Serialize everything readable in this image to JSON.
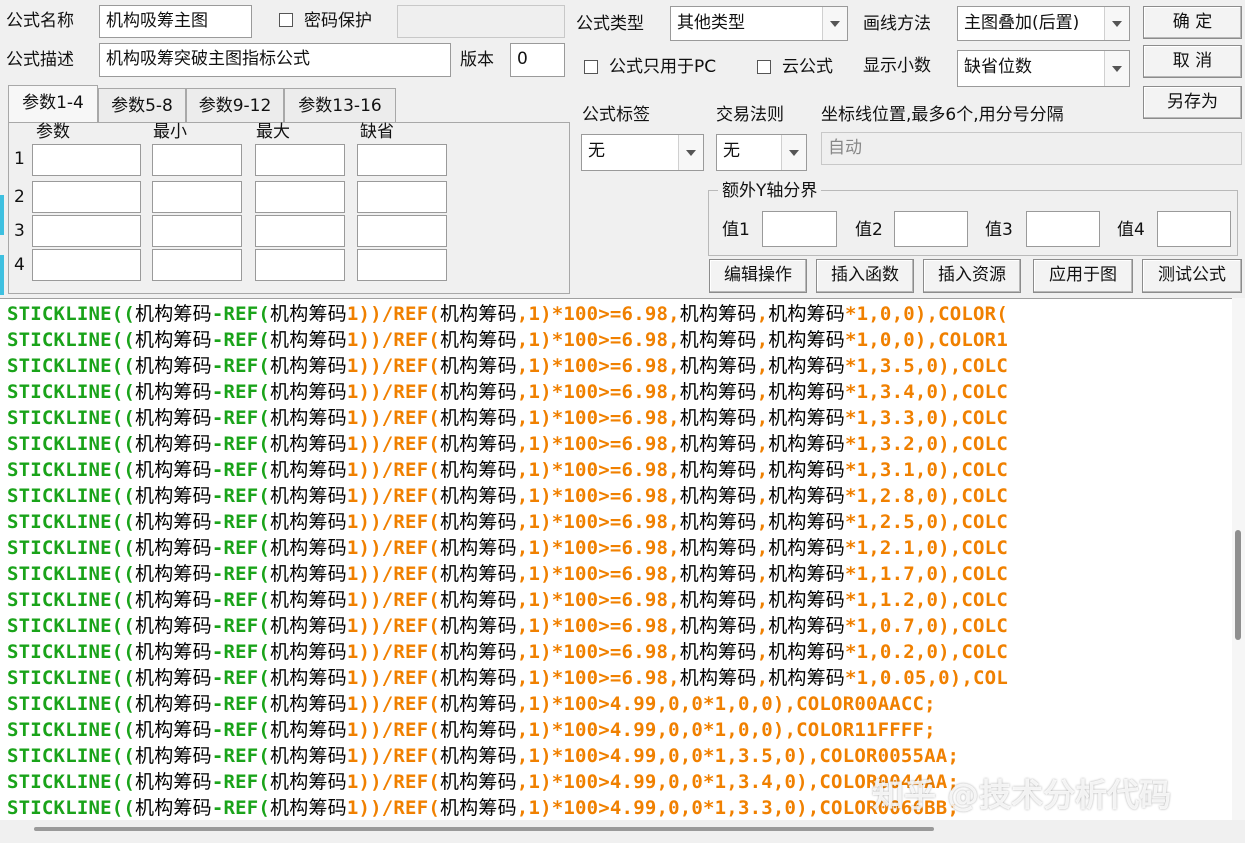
{
  "header": {
    "name_label": "公式名称",
    "name_value": "机构吸筹主图",
    "password_label": "密码保护",
    "password_value": "",
    "desc_label": "公式描述",
    "desc_value": "机构吸筹突破主图指标公式",
    "version_label": "版本",
    "version_value": "0",
    "type_label": "公式类型",
    "type_value": "其他类型",
    "draw_label": "画线方法",
    "draw_value": "主图叠加(后置)",
    "pc_only_label": "公式只用于PC",
    "cloud_label": "云公式",
    "decimal_label": "显示小数",
    "decimal_value": "缺省位数"
  },
  "buttons": {
    "ok": "确 定",
    "cancel": "取 消",
    "save_as": "另存为",
    "edit": "编辑操作",
    "insert_func": "插入函数",
    "insert_res": "插入资源",
    "apply": "应用于图",
    "test": "测试公式"
  },
  "tabs": [
    "参数1-4",
    "参数5-8",
    "参数9-12",
    "参数13-16"
  ],
  "params": {
    "headers": [
      "参数",
      "最小",
      "最大",
      "缺省"
    ],
    "rows": [
      "1",
      "2",
      "3",
      "4"
    ]
  },
  "right": {
    "tag_label": "公式标签",
    "tag_value": "无",
    "rule_label": "交易法则",
    "rule_value": "无",
    "coord_label": "坐标线位置,最多6个,用分号分隔",
    "coord_value": "自动",
    "yaxis_title": "额外Y轴分界",
    "y_labels": [
      "值1",
      "值2",
      "值3",
      "值4"
    ]
  },
  "code_lines": [
    {
      "pre": "1))/REF(",
      "post": "1)*100>=6.98,",
      "tail": "*1,0,0),COLOR("
    },
    {
      "pre": "1))/REF(",
      "post": "1)*100>=6.98,",
      "tail": "*1,0,0),COLOR1"
    },
    {
      "pre": "1))/REF(",
      "post": "1)*100>=6.98,",
      "tail": "*1,3.5,0),COLC"
    },
    {
      "pre": "1))/REF(",
      "post": "1)*100>=6.98,",
      "tail": "*1,3.4,0),COLC"
    },
    {
      "pre": "1))/REF(",
      "post": "1)*100>=6.98,",
      "tail": "*1,3.3,0),COLC"
    },
    {
      "pre": "1))/REF(",
      "post": "1)*100>=6.98,",
      "tail": "*1,3.2,0),COLC"
    },
    {
      "pre": "1))/REF(",
      "post": "1)*100>=6.98,",
      "tail": "*1,3.1,0),COLC"
    },
    {
      "pre": "1))/REF(",
      "post": "1)*100>=6.98,",
      "tail": "*1,2.8,0),COLC"
    },
    {
      "pre": "1))/REF(",
      "post": "1)*100>=6.98,",
      "tail": "*1,2.5,0),COLC"
    },
    {
      "pre": "1))/REF(",
      "post": "1)*100>=6.98,",
      "tail": "*1,2.1,0),COLC"
    },
    {
      "pre": "1))/REF(",
      "post": "1)*100>=6.98,",
      "tail": "*1,1.7,0),COLC"
    },
    {
      "pre": "1))/REF(",
      "post": "1)*100>=6.98,",
      "tail": "*1,1.2,0),COLC"
    },
    {
      "pre": "1))/REF(",
      "post": "1)*100>=6.98,",
      "tail": "*1,0.7,0),COLC"
    },
    {
      "pre": "1))/REF(",
      "post": "1)*100>=6.98,",
      "tail": "*1,0.2,0),COLC"
    },
    {
      "pre": "1))/REF(",
      "post": "1)*100>=6.98,",
      "tail": "*1,0.05,0),COL"
    },
    {
      "pre": "1))/REF(",
      "post": "1)*100>4.99,0,0*1,0,0),COLOR00AACC;",
      "tail": ""
    },
    {
      "pre": "1))/REF(",
      "post": "1)*100>4.99,0,0*1,0,0),COLOR11FFFF;",
      "tail": ""
    },
    {
      "pre": "1))/REF(",
      "post": "1)*100>4.99,0,0*1,3.5,0),COLOR0055AA;",
      "tail": ""
    },
    {
      "pre": "1))/REF(",
      "post": "1)*100>4.99,0,0*1,3.4,0),COLOR0044AA;",
      "tail": ""
    },
    {
      "pre": "1))/REF(",
      "post": "1)*100>4.99,0,0*1,3.3,0),COLOR0066BB;",
      "tail": ""
    }
  ],
  "code_strings": {
    "stickline": "STICKLINE((",
    "var": "机构筹码",
    "minus_ref": "-REF(",
    "comma": ",",
    "sep": ","
  },
  "watermark": "知乎 @技术分析代码",
  "colors": {
    "keyword": "#1aa31a",
    "number": "#f08000",
    "text": "#000000"
  }
}
